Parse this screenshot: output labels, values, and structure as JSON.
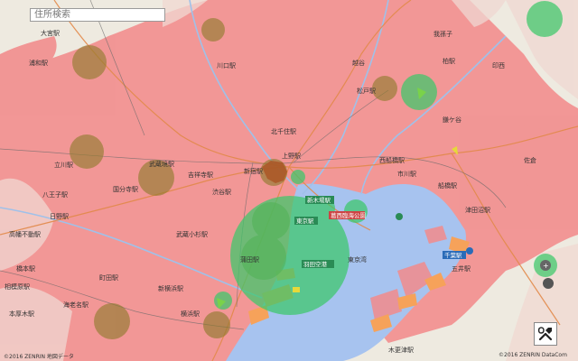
{
  "search": {
    "placeholder": "住所検索"
  },
  "places": {
    "takahata": "高幡不動駅",
    "hachioji": "八王子駅",
    "hino": "日野駅",
    "kokubunji": "国分寺駅",
    "tachikawa": "立川駅",
    "musashisakai": "武蔵境駅",
    "kichijoji": "吉祥寺駅",
    "shinjuku": "新宿駅",
    "ueno": "上野駅",
    "kitasenju": "北千住駅",
    "tokyo": "東京駅",
    "shinkiba": "新木場駅",
    "kasai": "葛西臨海公園",
    "nishifunabashi": "西船橋駅",
    "matsudo": "松戸駅",
    "kashiwa": "柏駅",
    "chiba": "千葉駅",
    "tsudanuma": "津田沼駅",
    "urawa": "浦和駅",
    "omiya": "大宮駅",
    "kawaguchi": "川口駅",
    "hashimoto": "橋本駅",
    "machida": "町田駅",
    "sagamihara": "相模原駅",
    "shinyokohama": "新横浜駅",
    "yokohama": "横浜駅",
    "kamata": "蒲田駅",
    "haneda": "羽田空港",
    "musashikosugi": "武蔵小杉駅",
    "shibuya": "渋谷駅",
    "ichikawa": "市川駅",
    "funabashi": "船橋駅",
    "goi": "五井駅",
    "kisarazu": "木更津駅",
    "ebina": "海老名駅",
    "atsugi": "本厚木駅",
    "tokyobay": "東京湾",
    "sakura": "佐倉",
    "inzai": "印西",
    "abiko": "我孫子",
    "koshigaya": "越谷",
    "kamagaya": "鎌ケ谷"
  },
  "copyright_left": "©2016 ZENRIN 地図データ",
  "copyright_right": "©2016 ZENRIN DataCom"
}
